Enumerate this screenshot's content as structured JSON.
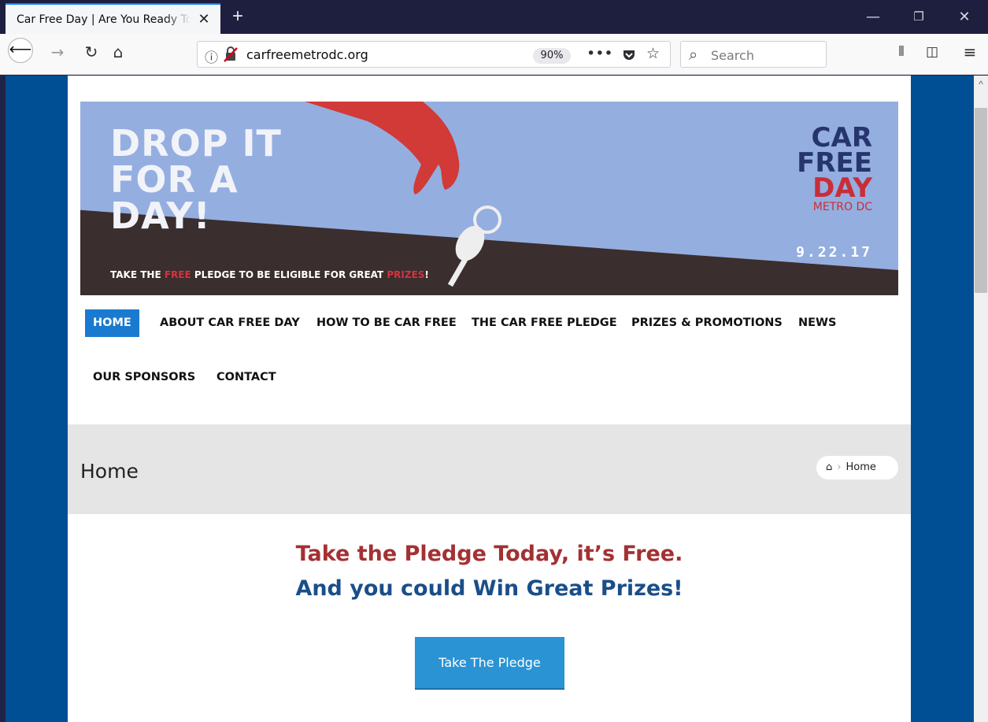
{
  "browser": {
    "tab_title": "Car Free Day | Are You Ready To Take",
    "url": "carfreemetrodc.org",
    "zoom": "90%",
    "search_placeholder": "Search",
    "accent_color": "#0a84ff"
  },
  "banner": {
    "headline_line1": "DROP IT",
    "headline_line2": "FOR A",
    "headline_line3": "DAY!",
    "sub_pre": "TAKE THE ",
    "sub_free": "FREE",
    "sub_mid": " PLEDGE TO BE ELIGIBLE FOR GREAT ",
    "sub_prizes": "PRIZES",
    "sub_end": "!",
    "logo_car": "CAR",
    "logo_free": "FREE",
    "logo_day": "DAY",
    "logo_metro": "METRO DC",
    "date": "9.22.17"
  },
  "menu": {
    "items": [
      {
        "label": "HOME",
        "active": true
      },
      {
        "label": "ABOUT CAR FREE DAY"
      },
      {
        "label": "HOW TO BE CAR FREE"
      },
      {
        "label": "THE CAR FREE PLEDGE"
      },
      {
        "label": "PRIZES & PROMOTIONS"
      },
      {
        "label": "NEWS"
      },
      {
        "label": "OUR SPONSORS"
      },
      {
        "label": "CONTACT"
      }
    ]
  },
  "page_header": {
    "title": "Home",
    "breadcrumb": "Home"
  },
  "content": {
    "line1": "Take the Pledge Today, it’s Free.",
    "line2": "And you could Win Great Prizes!",
    "cta": "Take The Pledge"
  },
  "colors": {
    "site_blue": "#004f94",
    "menu_active": "#1a7ad0",
    "pledge_red": "#a33133",
    "pledge_blue": "#1a4e89",
    "button": "#2a93d4"
  }
}
